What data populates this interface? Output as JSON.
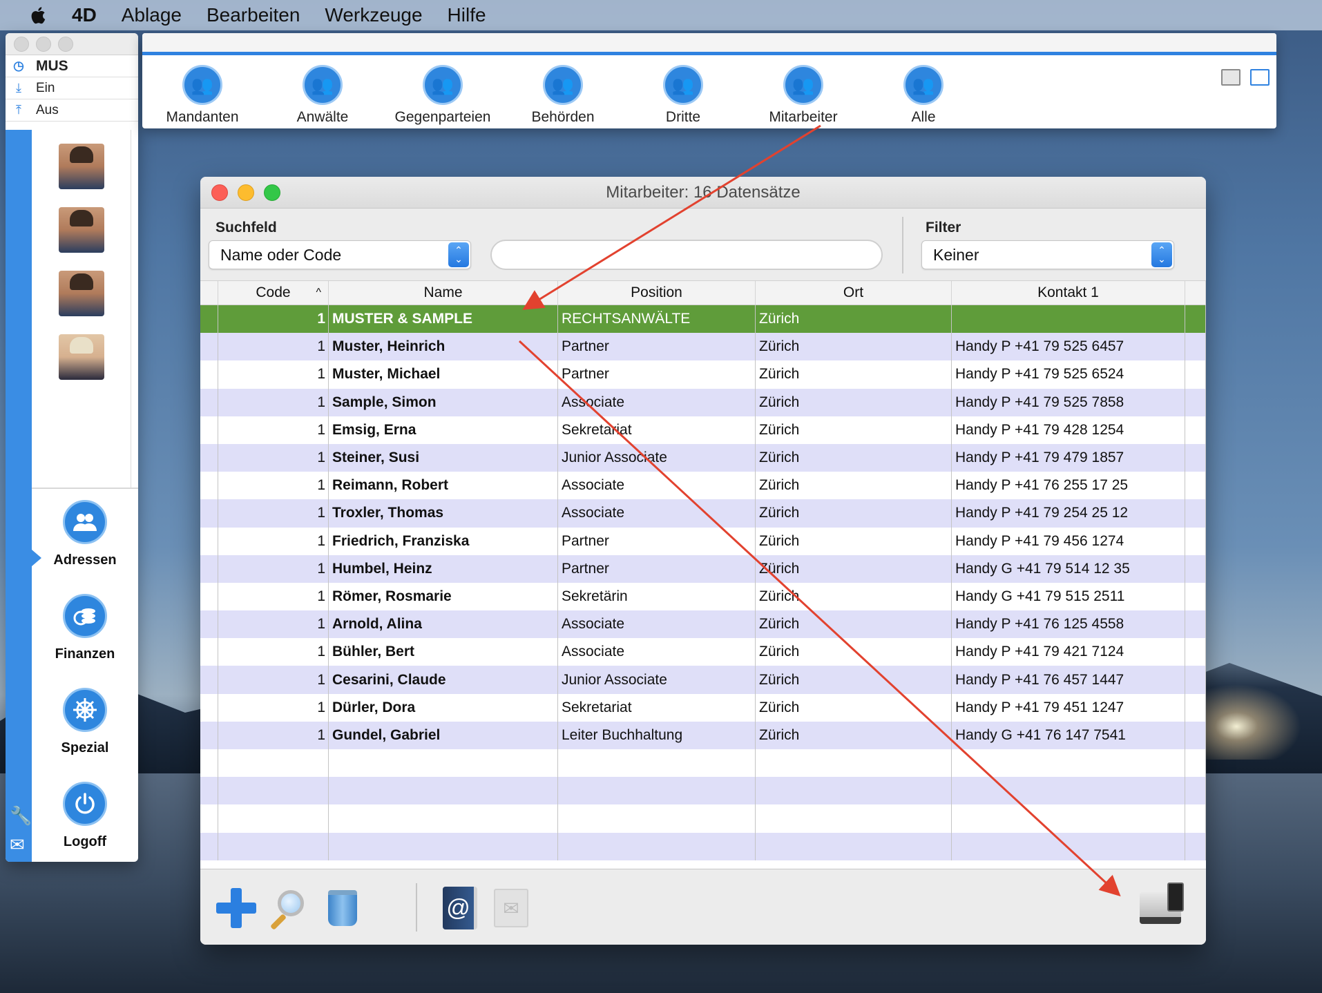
{
  "menubar": {
    "apple_icon": "apple-logo",
    "items": [
      "4D",
      "Ablage",
      "Bearbeiten",
      "Werkzeuge",
      "Hilfe"
    ]
  },
  "sidebar": {
    "user_code": "MUS",
    "in_label": "Ein",
    "out_label": "Aus",
    "nav": [
      {
        "label": "Adressen",
        "icon": "people-icon"
      },
      {
        "label": "Finanzen",
        "icon": "coins-icon"
      },
      {
        "label": "Spezial",
        "icon": "wheel-icon"
      },
      {
        "label": "Logoff",
        "icon": "power-icon"
      }
    ]
  },
  "categories": [
    "Mandanten",
    "Anwälte",
    "Gegenparteien",
    "Behörden",
    "Dritte",
    "Mitarbeiter",
    "Alle"
  ],
  "window": {
    "title": "Mitarbeiter: 16 Datensätze",
    "search_label": "Suchfeld",
    "search_field_value": "Name oder Code",
    "search_text": "",
    "filter_label": "Filter",
    "filter_value": "Keiner"
  },
  "table": {
    "columns": [
      "Code",
      "Name",
      "Position",
      "Ort",
      "Kontakt 1"
    ],
    "sort_indicator": "^",
    "rows": [
      {
        "code": "1",
        "name": "MUSTER & SAMPLE",
        "position": "RECHTSANWÄLTE",
        "ort": "Zürich",
        "kontakt": ""
      },
      {
        "code": "1",
        "name": "Muster, Heinrich",
        "position": "Partner",
        "ort": "Zürich",
        "kontakt": "Handy P +41 79 525 6457"
      },
      {
        "code": "1",
        "name": "Muster, Michael",
        "position": "Partner",
        "ort": "Zürich",
        "kontakt": "Handy P +41 79 525 6524"
      },
      {
        "code": "1",
        "name": "Sample, Simon",
        "position": "Associate",
        "ort": "Zürich",
        "kontakt": "Handy P +41 79 525 7858"
      },
      {
        "code": "1",
        "name": "Emsig, Erna",
        "position": "Sekretariat",
        "ort": "Zürich",
        "kontakt": "Handy P +41 79 428 1254"
      },
      {
        "code": "1",
        "name": "Steiner, Susi",
        "position": "Junior Associate",
        "ort": "Zürich",
        "kontakt": "Handy P +41 79 479 1857"
      },
      {
        "code": "1",
        "name": "Reimann, Robert",
        "position": "Associate",
        "ort": "Zürich",
        "kontakt": "Handy P +41 76 255 17 25"
      },
      {
        "code": "1",
        "name": "Troxler, Thomas",
        "position": "Associate",
        "ort": "Zürich",
        "kontakt": "Handy P +41 79 254 25 12"
      },
      {
        "code": "1",
        "name": "Friedrich, Franziska",
        "position": "Partner",
        "ort": "Zürich",
        "kontakt": "Handy P +41 79 456 1274"
      },
      {
        "code": "1",
        "name": "Humbel, Heinz",
        "position": "Partner",
        "ort": "Zürich",
        "kontakt": "Handy G +41 79 514 12 35"
      },
      {
        "code": "1",
        "name": "Römer, Rosmarie",
        "position": "Sekretärin",
        "ort": "Zürich",
        "kontakt": "Handy G +41 79 515 2511"
      },
      {
        "code": "1",
        "name": "Arnold, Alina",
        "position": "Associate",
        "ort": "Zürich",
        "kontakt": "Handy P +41 76 125 4558"
      },
      {
        "code": "1",
        "name": "Bühler, Bert",
        "position": "Associate",
        "ort": "Zürich",
        "kontakt": "Handy P +41 79 421 7124"
      },
      {
        "code": "1",
        "name": "Cesarini, Claude",
        "position": "Junior Associate",
        "ort": "Zürich",
        "kontakt": "Handy P +41 76 457 1447"
      },
      {
        "code": "1",
        "name": "Dürler, Dora",
        "position": "Sekretariat",
        "ort": "Zürich",
        "kontakt": "Handy P +41 79 451 1247"
      },
      {
        "code": "1",
        "name": "Gundel, Gabriel",
        "position": "Leiter Buchhaltung",
        "ort": "Zürich",
        "kontakt": "Handy G +41 76 147 7541"
      }
    ],
    "selected_row_color": "#5f9c3a",
    "stripe_color": "#dfdff8"
  },
  "bottom_toolbar": {
    "icons": [
      "add-icon",
      "search-icon",
      "trash-icon",
      "address-book-icon",
      "stamp-icon",
      "print-icon"
    ]
  },
  "annotation_color": "#e2422f"
}
